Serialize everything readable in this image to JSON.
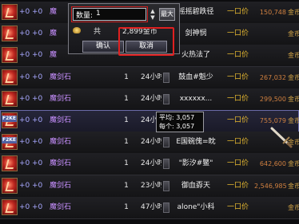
{
  "dialog": {
    "qty_label": "数量:",
    "qty_value": "1",
    "max_label": "最大",
    "gold_label": "共",
    "gold_value": "2,899金币",
    "ok_label": "确认",
    "cancel_label": "取消"
  },
  "tooltip": {
    "avg_label": "平均:",
    "avg_value": "3,057",
    "each_label": "每个:",
    "each_value": "3,057"
  },
  "rows": [
    {
      "plus1": "+0",
      "plus2": "+0",
      "name": "魔",
      "qty": "",
      "time": "",
      "seller": "摇摇碧跌径",
      "price_label": "一口价",
      "price": "150,748",
      "cur": "金币",
      "badge": ""
    },
    {
      "plus1": "+0",
      "plus2": "+0",
      "name": "魔",
      "qty": "",
      "time": "",
      "seller": "剑神悯",
      "price_label": "一口价",
      "price": "",
      "cur": "金币",
      "badge": ""
    },
    {
      "plus1": "+0",
      "plus2": "+0",
      "name": "魔",
      "qty": "",
      "time": "",
      "seller": "火热法了",
      "price_label": "一口价",
      "price": "",
      "cur": "金币",
      "badge": ""
    },
    {
      "plus1": "+0",
      "plus2": "+0",
      "name": "魔剑石",
      "qty": "1",
      "time": "24小时",
      "seller": "鼓血#魁少",
      "price_label": "一口价",
      "price": "267,032",
      "cur": "金币",
      "badge": ""
    },
    {
      "plus1": "+0",
      "plus2": "+0",
      "name": "魔剑石",
      "qty": "1",
      "time": "24小时",
      "seller": "xxxxxx...",
      "price_label": "一口价",
      "price": "299,500",
      "cur": "金币",
      "badge": ""
    },
    {
      "plus1": "+0",
      "plus2": "+0",
      "name": "魔剑石",
      "qty": "1",
      "time": "24小时",
      "seller": "",
      "price_label": "一口价",
      "price": "755,079",
      "cur": "金币",
      "badge": "F2KE"
    },
    {
      "plus1": "+0",
      "plus2": "+0",
      "name": "魔剑石",
      "qty": "1",
      "time": "24小时",
      "seller": "E国碗傀=眈",
      "price_label": "一口价",
      "price": "",
      "cur": "金币",
      "badge": "F2KE"
    },
    {
      "plus1": "+0",
      "plus2": "+0",
      "name": "魔剑石",
      "qty": "1",
      "time": "24小时",
      "seller": "\"影汐#鳖\"",
      "price_label": "一口价",
      "price": "642,600",
      "cur": "金币",
      "badge": ""
    },
    {
      "plus1": "+0",
      "plus2": "+0",
      "name": "魔剑石",
      "qty": "1",
      "time": "23小时",
      "seller": "御血孬天",
      "price_label": "一口价",
      "price": "2,546,985",
      "cur": "金币",
      "badge": ""
    },
    {
      "plus1": "+0",
      "plus2": "+0",
      "name": "魔剑石",
      "qty": "1",
      "time": "47小时",
      "seller": "alone\"小科",
      "price_label": "一口价",
      "price": "",
      "cur": "金币",
      "badge": ""
    }
  ]
}
